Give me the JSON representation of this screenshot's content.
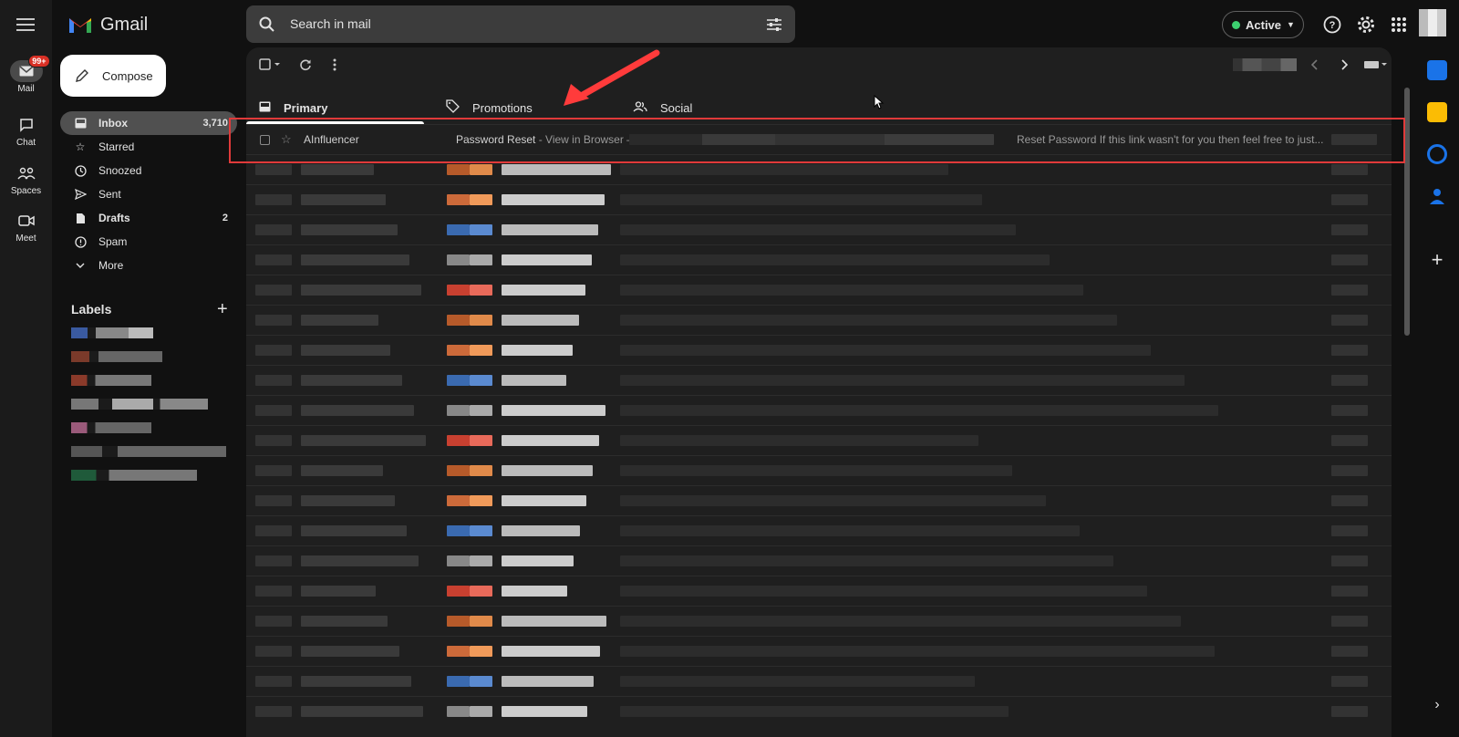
{
  "app": {
    "name": "Gmail"
  },
  "rail": [
    {
      "label": "Mail",
      "badge": "99+"
    },
    {
      "label": "Chat"
    },
    {
      "label": "Spaces"
    },
    {
      "label": "Meet"
    }
  ],
  "search": {
    "placeholder": "Search in mail"
  },
  "status": {
    "label": "Active"
  },
  "compose": {
    "label": "Compose"
  },
  "nav": [
    {
      "label": "Inbox",
      "count": "3,710"
    },
    {
      "label": "Starred"
    },
    {
      "label": "Snoozed"
    },
    {
      "label": "Sent"
    },
    {
      "label": "Drafts",
      "count": "2"
    },
    {
      "label": "Spam"
    },
    {
      "label": "More"
    }
  ],
  "labels": {
    "title": "Labels"
  },
  "tabs": [
    {
      "label": "Primary",
      "icon": "inbox-icon"
    },
    {
      "label": "Promotions",
      "icon": "tag-icon"
    },
    {
      "label": "Social",
      "icon": "people-icon"
    }
  ],
  "emails": [
    {
      "sender": "AInfluencer",
      "subject": "Password Reset",
      "snippet_start": " - View in Browser –",
      "snippet_end": "Reset Password If this link wasn't for you then feel free to just..."
    }
  ],
  "colors": {
    "accent": "#e03a3a",
    "active_dot": "#3ccf6f",
    "badge": "#d93025"
  }
}
